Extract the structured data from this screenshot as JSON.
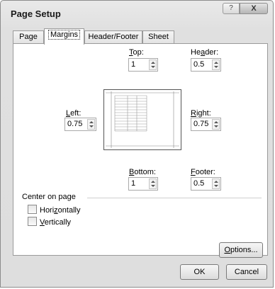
{
  "window": {
    "title": "Page Setup",
    "help_label": "?",
    "close_label": "X"
  },
  "tabs": [
    {
      "label": "Page",
      "active": false
    },
    {
      "label": "Margins",
      "active": true
    },
    {
      "label": "Header/Footer",
      "active": false
    },
    {
      "label": "Sheet",
      "active": false
    }
  ],
  "margins": {
    "top": {
      "label_ul": "T",
      "label_rest": "op:",
      "value": "1"
    },
    "header": {
      "label_pre": "He",
      "label_ul": "a",
      "label_rest": "der:",
      "value": "0.5"
    },
    "left": {
      "label_ul": "L",
      "label_rest": "eft:",
      "value": "0.75"
    },
    "right": {
      "label_ul": "R",
      "label_rest": "ight:",
      "value": "0.75"
    },
    "bottom": {
      "label_ul": "B",
      "label_rest": "ottom:",
      "value": "1"
    },
    "footer": {
      "label_ul": "F",
      "label_rest": "ooter:",
      "value": "0.5"
    }
  },
  "center_on_page": {
    "label": "Center on page",
    "horizontally": {
      "label_pre": "Hori",
      "label_ul": "z",
      "label_rest": "ontally",
      "checked": false
    },
    "vertically": {
      "label_ul": "V",
      "label_rest": "ertically",
      "checked": false
    }
  },
  "buttons": {
    "options": {
      "label_ul": "O",
      "label_rest": "ptions..."
    },
    "ok": "OK",
    "cancel": "Cancel"
  }
}
